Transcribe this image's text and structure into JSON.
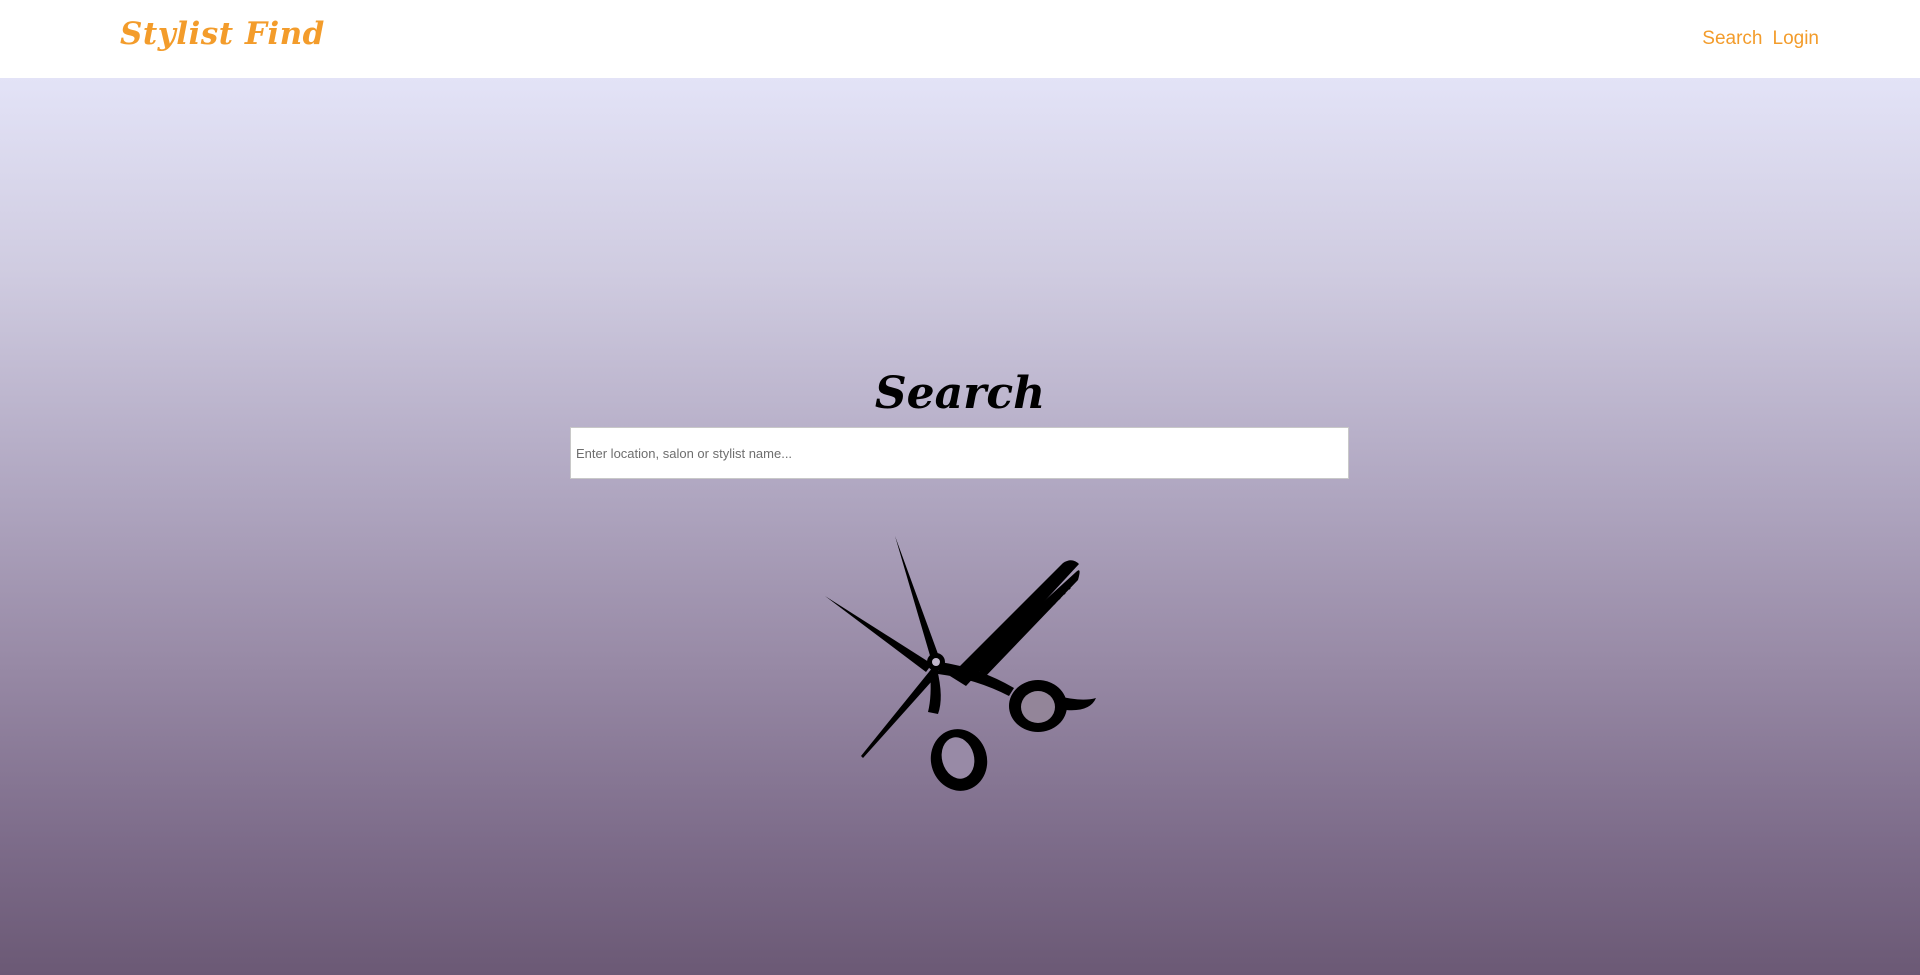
{
  "navbar": {
    "brand": "Stylist Find",
    "links": [
      "Search",
      "Login"
    ]
  },
  "hero": {
    "title": "Search",
    "search_placeholder": "Enter location, salon or stylist name...",
    "search_value": "",
    "illustration_icon": "scissors-and-comb-icon"
  },
  "colors": {
    "accent": "#f39c2b",
    "gradient_top": "#e3e3f7",
    "gradient_bottom": "#6b5975"
  }
}
